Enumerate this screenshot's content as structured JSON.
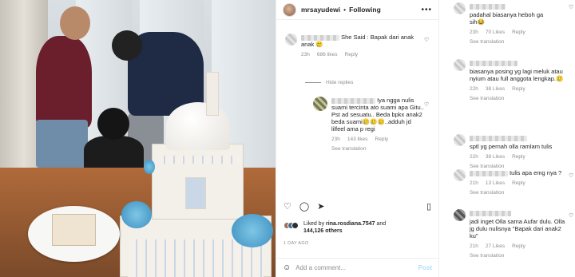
{
  "post": {
    "username": "mrsayudewi",
    "follow_status": "Following",
    "more_icon": "more-horizontal-icon"
  },
  "comments_mid": [
    {
      "text": "She Said : Bapak dari anak anak 🥲",
      "age": "23h",
      "likes": "686 likes",
      "reply": "Reply"
    },
    {
      "hide_replies": "Hide replies"
    },
    {
      "text": "Iya ngga nulis suami tercinta ato suami apa Gitu.. Pst ad sesuatu.. Beda bpkx anak2 beda suami🥲🥲🥲..adduh jd lilfeel ama p regi",
      "age": "23h",
      "likes": "143 likes",
      "reply": "Reply",
      "see_translation": "See translation"
    }
  ],
  "actions": {
    "like": "like-icon",
    "comment": "comment-icon",
    "share": "share-icon",
    "save": "bookmark-icon"
  },
  "liked_by": {
    "prefix": "Liked by",
    "user": "rina.rosdiana.7547",
    "and": "and",
    "others": "144,126 others"
  },
  "time_ago": "1 DAY AGO",
  "add_comment": {
    "placeholder": "Add a comment...",
    "post": "Post"
  },
  "comments_right": [
    {
      "text": "padahal biasanya heboh ga sih😂",
      "age": "23h",
      "likes": "70 Likes",
      "reply": "Reply",
      "see_translation": "See translation"
    },
    {
      "text": "biasanya posing yg lagi meluk atau nyium atau full anggota lengkap.🥲",
      "age": "22h",
      "likes": "38 Likes",
      "reply": "Reply",
      "see_translation": "See translation"
    },
    {
      "text": "sptl yg pernah olla ramlam tulis",
      "age": "22h",
      "likes": "38 Likes",
      "reply": "Reply",
      "see_translation": "See translation"
    },
    {
      "text": "tulis apa emg nya ?",
      "age": "21h",
      "likes": "13 Likes",
      "reply": "Reply",
      "see_translation": "See translation"
    },
    {
      "text": "jadi inget Olla sama Aufar dulu. Olla jg dulu nulisnya \"Bapak dari anak2 ku\"",
      "age": "21h",
      "likes": "27 Likes",
      "reply": "Reply",
      "see_translation": "See translation"
    }
  ],
  "colors": {
    "text": "#262626",
    "muted": "#8e8e8e",
    "link": "#00376b",
    "post_disabled": "#b2dffc"
  }
}
